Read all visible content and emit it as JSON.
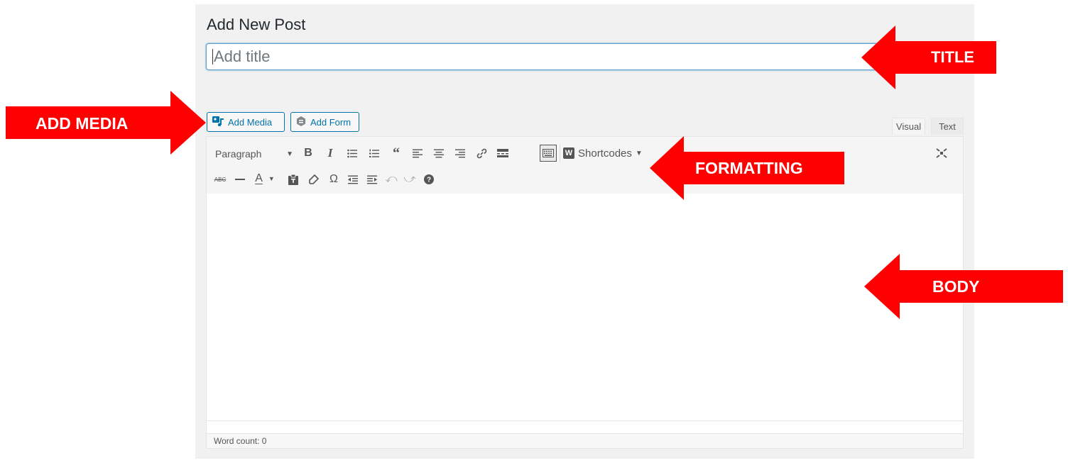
{
  "page": {
    "title": "Add New Post"
  },
  "title_field": {
    "placeholder": "Add title",
    "value": ""
  },
  "media_buttons": {
    "add_media": "Add Media",
    "add_form": "Add Form"
  },
  "editor_tabs": {
    "visual": "Visual",
    "text": "Text",
    "active": "Visual"
  },
  "toolbar": {
    "format_select": "Paragraph",
    "shortcodes": "Shortcodes",
    "shortcodes_badge": "W",
    "row1_icons": [
      "bold-icon",
      "italic-icon",
      "bullet-list-icon",
      "numbered-list-icon",
      "blockquote-icon",
      "align-left-icon",
      "align-center-icon",
      "align-right-icon",
      "link-icon",
      "read-more-icon",
      "toolbar-toggle-icon",
      "shortcodes-icon",
      "fullscreen-icon"
    ],
    "row2_icons": [
      "strikethrough-icon",
      "horizontal-line-icon",
      "text-color-icon",
      "paste-text-icon",
      "clear-formatting-icon",
      "special-character-icon",
      "outdent-icon",
      "indent-icon",
      "undo-icon",
      "redo-icon",
      "help-icon"
    ]
  },
  "status_bar": {
    "word_count": "Word count: 0"
  },
  "callouts": {
    "title": "TITLE",
    "add_media": "ADD MEDIA",
    "formatting": "FORMATTING",
    "body": "BODY",
    "color": "#ff0000"
  }
}
